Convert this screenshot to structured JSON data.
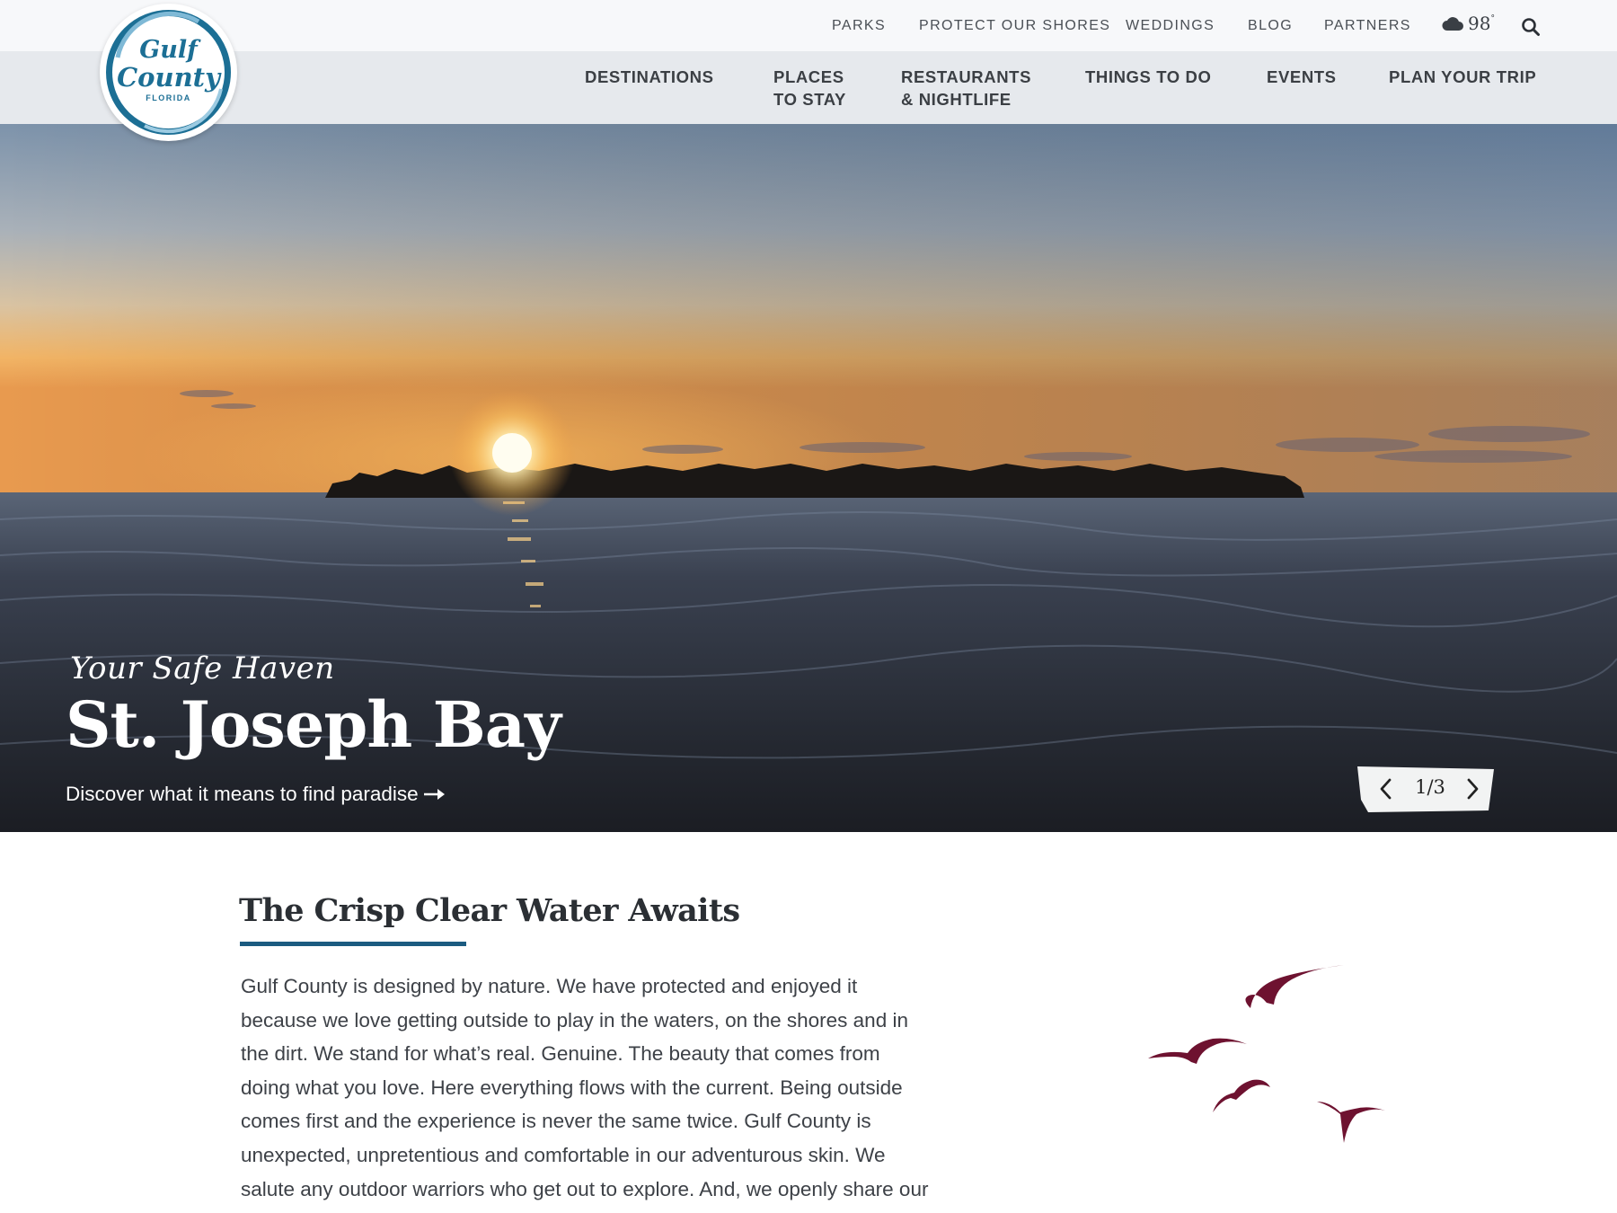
{
  "logo": {
    "line1": "Gulf",
    "line2": "County",
    "line3": "FLORIDA"
  },
  "utility_nav": {
    "items": [
      "PARKS",
      "PROTECT OUR SHORES",
      "WEDDINGS",
      "BLOG",
      "PARTNERS"
    ],
    "weather_temp": "98",
    "weather_unit": "°",
    "weather_icon": "cloud-icon",
    "search_icon": "search-icon"
  },
  "main_nav": {
    "items": [
      {
        "line1": "DESTINATIONS",
        "line2": ""
      },
      {
        "line1": "PLACES",
        "line2": "TO STAY"
      },
      {
        "line1": "RESTAURANTS",
        "line2": "& NIGHTLIFE"
      },
      {
        "line1": "THINGS TO DO",
        "line2": ""
      },
      {
        "line1": "EVENTS",
        "line2": ""
      },
      {
        "line1": "PLAN YOUR TRIP",
        "line2": ""
      }
    ]
  },
  "hero": {
    "script": "Your Safe Haven",
    "title": "St. Joseph Bay",
    "link_text": "Discover what it means to find paradise",
    "counter": "1/3"
  },
  "content": {
    "title": "The Crisp Clear Water Awaits",
    "paragraph_lines": [
      "Gulf County is designed by nature. We have protected and enjoyed it",
      "because we love getting outside to play in the waters, on the shores and in",
      "the dirt. We stand for what’s real. Genuine. The beauty that comes from",
      "doing what you love. Here everything flows with the current. Being outside",
      "comes first and the experience is never the same twice. Gulf County is",
      "unexpected, unpretentious and comfortable in our adventurous skin. We",
      "salute any outdoor warriors who get out to explore. And, we openly share our"
    ]
  },
  "colors": {
    "accent_blue": "#1b5b80",
    "bird_maroon": "#6e1230",
    "logo_blue": "#1c6f95"
  }
}
